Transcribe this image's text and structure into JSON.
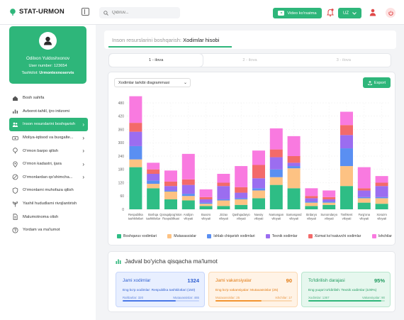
{
  "app": {
    "name": "STAT-URMON"
  },
  "search": {
    "placeholder": "Qidiruv..."
  },
  "header": {
    "video_label": "Video ko'rsatma",
    "lang": "UZ"
  },
  "profile": {
    "name": "Odilxon Yuldoshxonov",
    "user_number_label": "User number:",
    "user_number": "123654",
    "org_label": "Tashkilot:",
    "org": "Urmontexnoservis"
  },
  "menu": [
    {
      "label": "Bosh sahifa",
      "icon": "home-icon",
      "chevron": false
    },
    {
      "label": "Avborot-tahlil, ijro intizomi",
      "icon": "chart-icon",
      "chevron": false
    },
    {
      "label": "Inson resurslarini boshqarish",
      "icon": "users-icon",
      "chevron": true
    },
    {
      "label": "Moliya-iqtisod va buxgalte...",
      "icon": "money-icon",
      "chevron": true
    },
    {
      "label": "O'rmon barpo qilish",
      "icon": "tree-icon",
      "chevron": true
    },
    {
      "label": "O'rmon kadastri, ijara",
      "icon": "map-icon",
      "chevron": true
    },
    {
      "label": "O'rmonlardan qo'shimcha...",
      "icon": "leaf-icon",
      "chevron": true
    },
    {
      "label": "O'rmonlarni muhofaza qilish",
      "icon": "shield-icon",
      "chevron": false
    },
    {
      "label": "Yashil hududlarni rivojlantirish",
      "icon": "sprout-icon",
      "chevron": false
    },
    {
      "label": "Malumotnoma olish",
      "icon": "document-icon",
      "chevron": false
    },
    {
      "label": "Yordam va ma'lumot",
      "icon": "help-icon",
      "chevron": false
    }
  ],
  "breadcrumb": {
    "parent": "Inson resurslarini boshqarish:",
    "current": "Xodimlar hisobi"
  },
  "tabs": [
    "1 - ilova",
    "2 - ilova",
    "3 - ilova"
  ],
  "chart_controls": {
    "select": "Xodimlar tarkibi diagrammasi",
    "export": "Export"
  },
  "colors": {
    "accent": "#2eb67a"
  },
  "chart_data": {
    "type": "bar",
    "stacked": true,
    "ylim": [
      0,
      480
    ],
    "yticks": [
      0,
      60,
      120,
      180,
      240,
      300,
      360,
      420,
      480
    ],
    "grid": true,
    "legend_position": "bottom",
    "categories": [
      [
        "Respublika",
        "tashkilotlari"
      ],
      [
        "Boshqa",
        "tashkilotlar"
      ],
      [
        "Qoraqalpog'iston",
        "Respublikasi"
      ],
      [
        "Andijon",
        "viloyati"
      ],
      [
        "Buxoro",
        "viloyati"
      ],
      [
        "Jizzax",
        "viloyati"
      ],
      [
        "Qashqadaryo",
        "viloyati"
      ],
      [
        "Navoiy",
        "viloyati"
      ],
      [
        "Namangan",
        "viloyati"
      ],
      [
        "Samarqand",
        "viloyati"
      ],
      [
        "Sirdaryo",
        "viloyati"
      ],
      [
        "Surxondaryo",
        "viloyati"
      ],
      [
        "Toshkent",
        "viloyati"
      ],
      [
        "Farg'ona",
        "viloyati"
      ],
      [
        "Xorazm",
        "viloyati"
      ]
    ],
    "series": [
      {
        "name": "Boshqaruv xodimlari",
        "color": "#2ebd85",
        "values": [
          190,
          95,
          45,
          40,
          15,
          15,
          20,
          50,
          110,
          95,
          15,
          20,
          105,
          30,
          25
        ]
      },
      {
        "name": "Mutaxassislar",
        "color": "#fdc283",
        "values": [
          35,
          20,
          35,
          20,
          10,
          25,
          25,
          35,
          35,
          90,
          15,
          10,
          90,
          20,
          25
        ]
      },
      {
        "name": "Ishlab chiqarish xodimlari",
        "color": "#5a8ff2",
        "values": [
          60,
          15,
          5,
          10,
          5,
          5,
          5,
          10,
          35,
          10,
          5,
          5,
          80,
          5,
          5
        ]
      },
      {
        "name": "Texnik xodimlar",
        "color": "#9b6df0",
        "values": [
          65,
          30,
          20,
          40,
          15,
          60,
          25,
          45,
          55,
          15,
          15,
          10,
          60,
          30,
          50
        ]
      },
      {
        "name": "Xizmat ko'rsatuvchi xodimlar",
        "color": "#f36a6a",
        "values": [
          40,
          20,
          20,
          25,
          10,
          15,
          25,
          60,
          35,
          30,
          10,
          10,
          45,
          10,
          15
        ]
      },
      {
        "name": "Ishchilar",
        "color": "#f97ae0",
        "values": [
          120,
          30,
          50,
          115,
          35,
          40,
          95,
          65,
          95,
          90,
          35,
          30,
          60,
          95,
          30
        ]
      }
    ]
  },
  "summary": {
    "title": "Jadval bo'yicha qisqacha ma'lumot",
    "cards": [
      {
        "title": "Jami xodimlar",
        "value": "1324",
        "detail": "Eng ko'p xodimlar: Respublika tashkilotlari (150)",
        "left": "Rahbarlar: 320",
        "right": "Mutaxassislar: 465",
        "fill": 0.69,
        "bg": "#e8efff",
        "border": "#c7d6fb",
        "text": "#2f5fd0",
        "barbg": "#c7d6fb",
        "barfg": "#4a78e8"
      },
      {
        "title": "Jami vakansiyalar",
        "value": "90",
        "detail": "Eng ko'p vakansiyalar: Mutaxassislar (25)",
        "left": "Mutaxassislar: 25",
        "right": "Ishchilar: 17",
        "fill": 0.6,
        "bg": "#fff3e6",
        "border": "#fbd9b3",
        "text": "#e27a12",
        "barbg": "#fbd9b3",
        "barfg": "#f39430"
      },
      {
        "title": "To'ldirilish darajasi",
        "value": "95%",
        "detail": "Eng yuqori to'ldirilish: Texnik xodimlar (100%)",
        "left": "Xodimlar: 1367",
        "right": "Vakansiyalar: 90",
        "fill": 0.95,
        "bg": "#e6f7ee",
        "border": "#b8e6cd",
        "text": "#1f9a5e",
        "barbg": "#b8e6cd",
        "barfg": "#2eb67a"
      }
    ]
  }
}
